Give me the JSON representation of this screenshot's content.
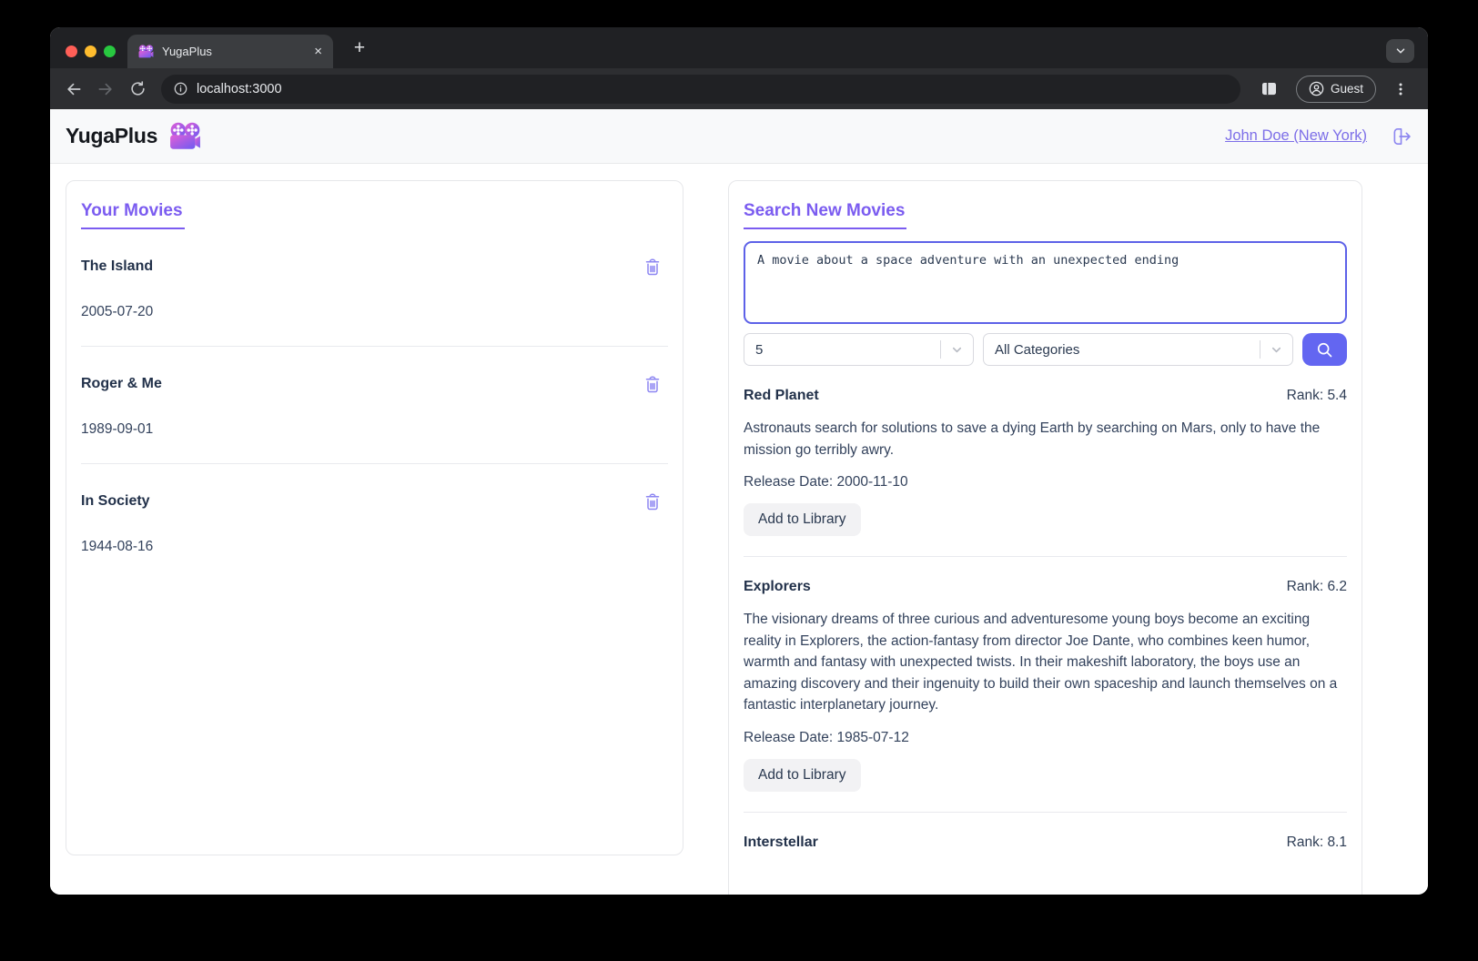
{
  "browser": {
    "tab_title": "YugaPlus",
    "url": "localhost:3000",
    "guest_label": "Guest",
    "new_tab_glyph": "+",
    "close_tab_glyph": "×"
  },
  "app_header": {
    "brand": "YugaPlus",
    "user": "John Doe (New York)"
  },
  "your_movies": {
    "heading": "Your Movies",
    "items": [
      {
        "title": "The Island",
        "date": "2005-07-20"
      },
      {
        "title": "Roger & Me",
        "date": "1989-09-01"
      },
      {
        "title": "In Society",
        "date": "1944-08-16"
      }
    ]
  },
  "search": {
    "heading": "Search New Movies",
    "query": "A movie about a space adventure with an unexpected ending",
    "limit": "5",
    "category": "All Categories",
    "results": [
      {
        "title": "Red Planet",
        "rank": "Rank: 5.4",
        "description": "Astronauts search for solutions to save a dying Earth by searching on Mars, only to have the mission go terribly awry.",
        "release": "Release Date: 2000-11-10",
        "action": "Add to Library"
      },
      {
        "title": "Explorers",
        "rank": "Rank: 6.2",
        "description": "The visionary dreams of three curious and adventuresome young boys become an exciting reality in Explorers, the action-fantasy from director Joe Dante, who combines keen humor, warmth and fantasy with unexpected twists. In their makeshift laboratory, the boys use an amazing discovery and their ingenuity to build their own spaceship and launch themselves on a fantastic interplanetary journey.",
        "release": "Release Date: 1985-07-12",
        "action": "Add to Library"
      },
      {
        "title": "Interstellar",
        "rank": "Rank: 8.1"
      }
    ]
  },
  "colors": {
    "accent_indigo": "#6366f1",
    "heading_purple": "#7b5cf0",
    "link_purple": "#7d6fe8",
    "trash_purple": "#8d86f2",
    "text_navy": "#2e3d55"
  }
}
